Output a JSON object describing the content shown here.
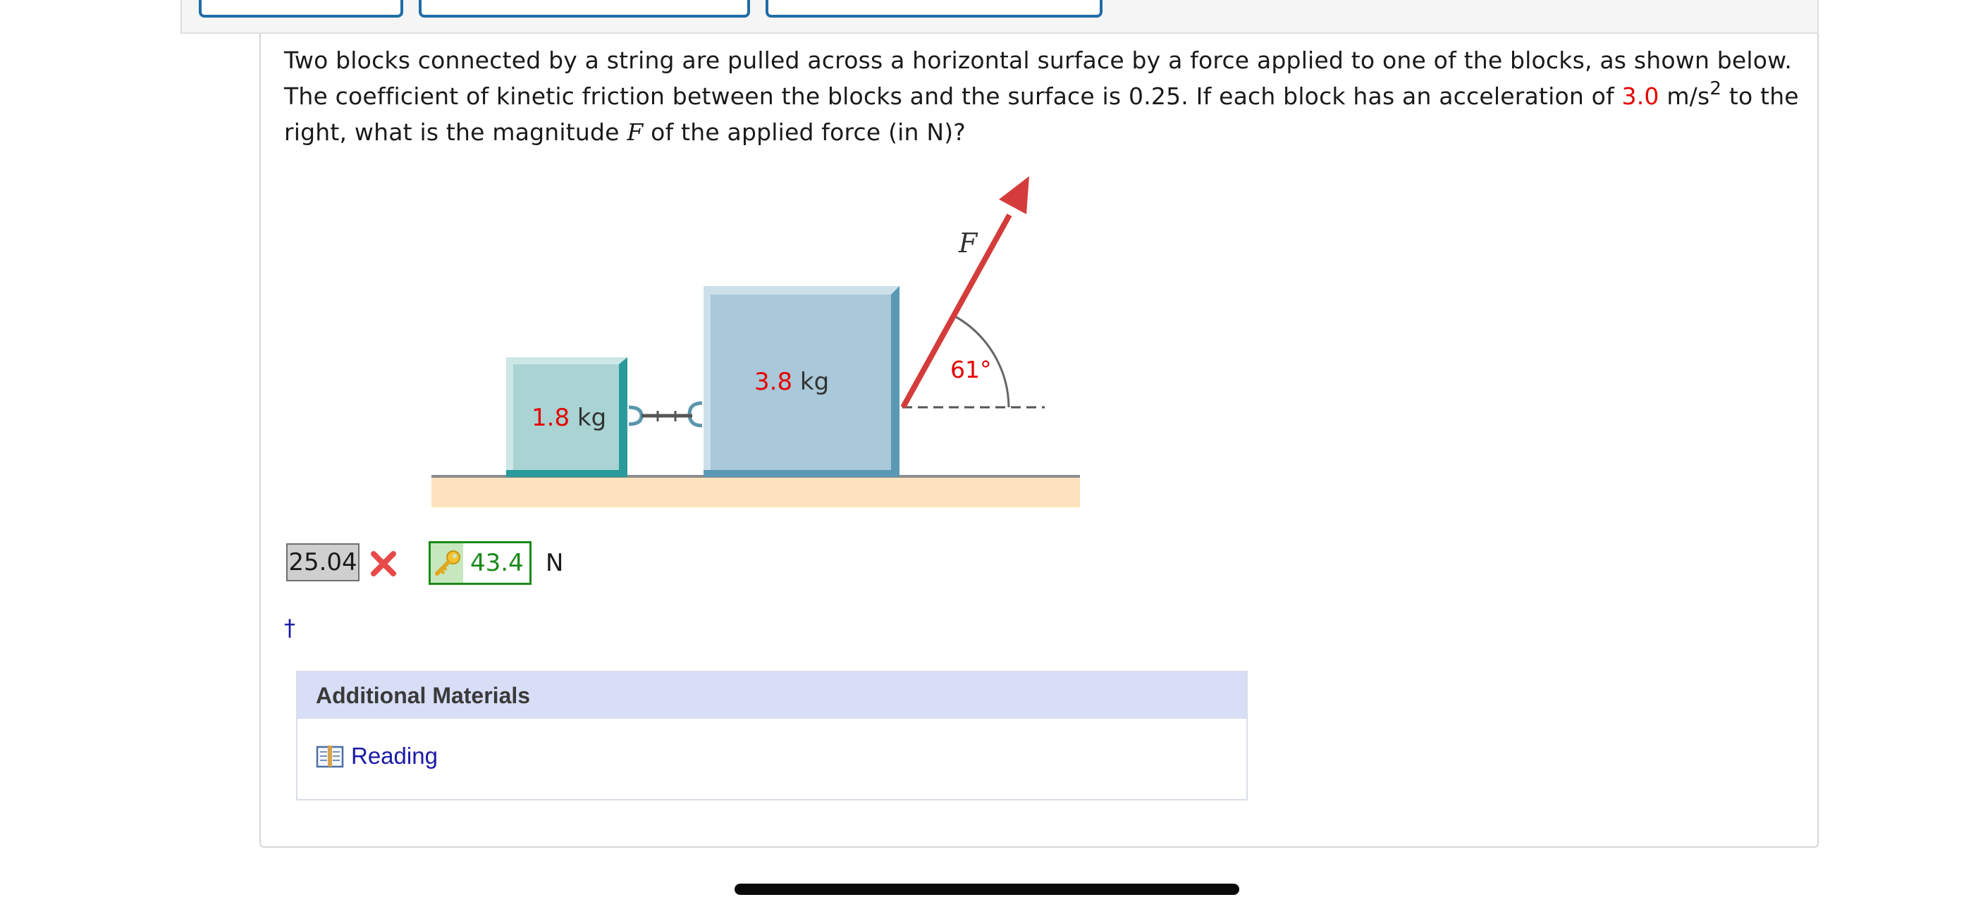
{
  "question": {
    "part1": "Two blocks connected by a string are pulled across a horizontal surface by a force applied to one of the blocks, as shown below. The coefficient of kinetic friction between the blocks and the surface is 0.25. If each block has an acceleration of ",
    "acceleration_value": "3.0",
    "acceleration_unit": " m/s",
    "acceleration_exp": "2",
    "part2": " to the right, what is the magnitude ",
    "force_symbol": "F",
    "part3": " of the applied force (in N)?"
  },
  "figure": {
    "block_small_mass": "1.8",
    "block_large_mass": "3.8",
    "mass_unit": "kg",
    "force_label": "F",
    "angle_value": "61",
    "angle_unit": "°"
  },
  "answer": {
    "submitted": "25.04",
    "correct": "43.4",
    "unit": "N"
  },
  "footnote": {
    "dagger": "†"
  },
  "materials": {
    "header": "Additional Materials",
    "link": "Reading"
  },
  "colors": {
    "accent_red": "#e60000",
    "correct_green": "#1a8a1a",
    "link_blue": "#1a1aa6",
    "tab_border": "#1f6da7",
    "materials_header_bg": "#d8def6"
  },
  "icons": {
    "wrong_mark": "x-mark-icon",
    "answer_key": "key-icon",
    "reading": "book-icon"
  }
}
